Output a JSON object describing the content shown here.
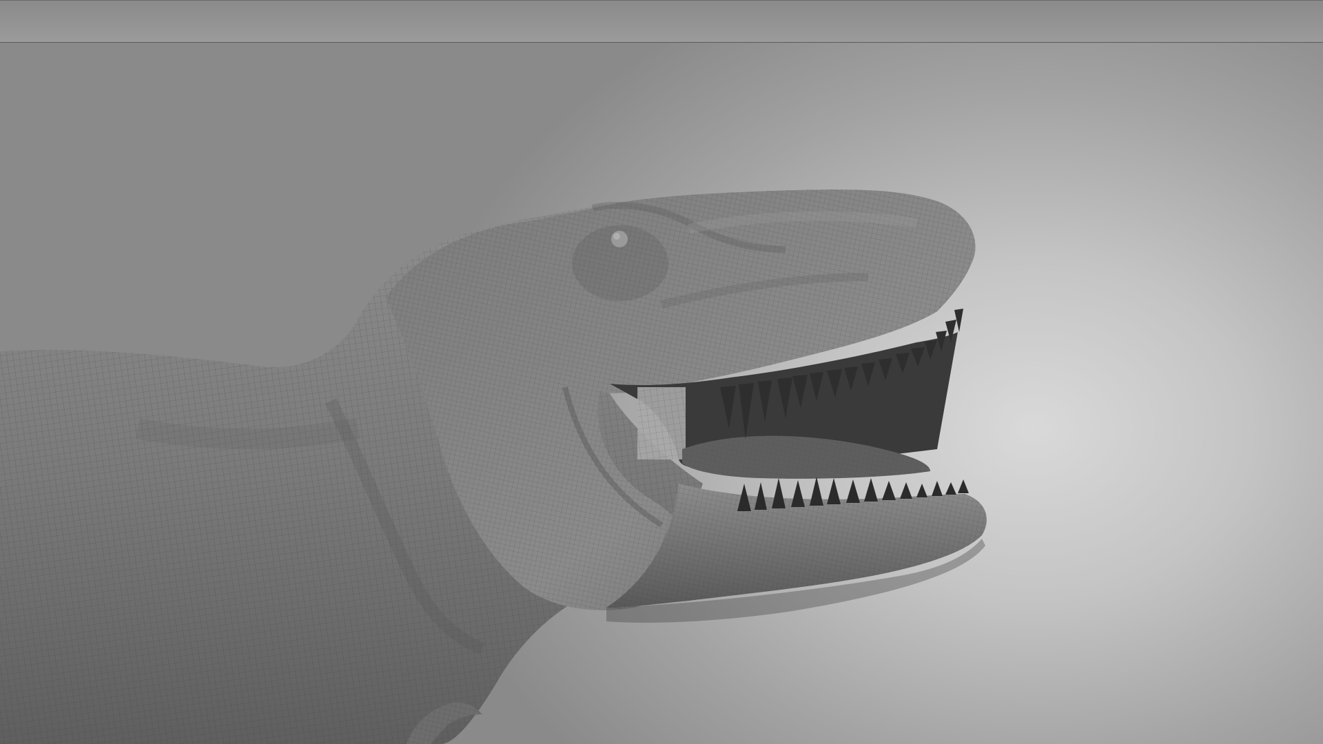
{
  "viewport": {
    "subject": "t-rex-head-wireframe",
    "colors": {
      "background_light": "#d9d9d9",
      "background_dark": "#8a8a8a",
      "skin": "#7d7d7d",
      "skin_shadow": "#4a4a4a",
      "wire": "#3c3c3c",
      "teeth": "#2e2e2e",
      "mouth": "#3a3a3a"
    }
  }
}
